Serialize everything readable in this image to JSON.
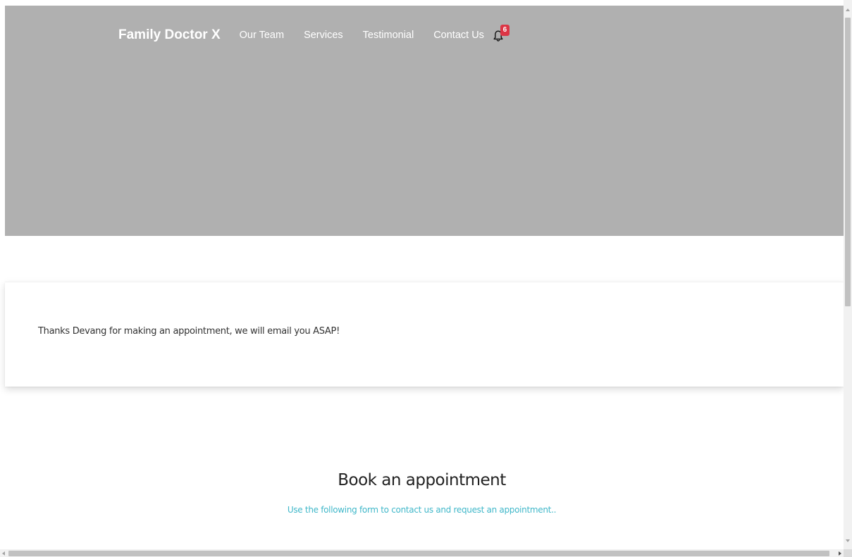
{
  "navbar": {
    "brand": "Family Doctor X",
    "links": [
      {
        "label": "Our Team"
      },
      {
        "label": "Services"
      },
      {
        "label": "Testimonial"
      },
      {
        "label": "Contact Us"
      }
    ],
    "notifications": {
      "icon": "bell-icon",
      "count": "6",
      "badge_color": "#dc3545"
    }
  },
  "hero": {
    "background_color": "#b0b0b0"
  },
  "confirmation": {
    "message": "Thanks Devang for making an appointment, we will email you ASAP!"
  },
  "appointment_section": {
    "title": "Book an appointment",
    "subtitle": "Use the following form to contact us and request an appointment..",
    "subtitle_color": "#3fb7c9"
  }
}
